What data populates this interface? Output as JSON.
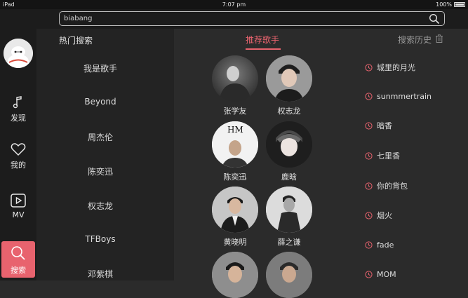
{
  "status_bar": {
    "device": "iPad",
    "time": "7:07 pm",
    "battery": "100%"
  },
  "search": {
    "value": "biabang"
  },
  "sidebar": {
    "items": [
      {
        "label": "发现",
        "icon": "music-note-icon"
      },
      {
        "label": "我的",
        "icon": "heart-icon"
      },
      {
        "label": "MV",
        "icon": "play-icon"
      },
      {
        "label": "搜索",
        "icon": "search-icon"
      }
    ]
  },
  "hot_search": {
    "title": "热门搜索",
    "items": [
      "我是歌手",
      "Beyond",
      "周杰伦",
      "陈奕迅",
      "权志龙",
      "TFBoys",
      "邓紫棋"
    ]
  },
  "tabs": {
    "recommended": "推荐歌手",
    "history": "搜索历史"
  },
  "singers": [
    "张学友",
    "权志龙",
    "陈奕迅",
    "鹿晗",
    "黄晓明",
    "薛之谦"
  ],
  "history": [
    "城里的月光",
    "sunmmertrain",
    "暗香",
    "七里香",
    "你的背包",
    "烟火",
    "fade",
    "MOM"
  ],
  "colors": {
    "accent": "#e8636e",
    "sidebar": "#1c1c1c",
    "hot_column": "#232323",
    "panel": "#2b2b2b"
  }
}
